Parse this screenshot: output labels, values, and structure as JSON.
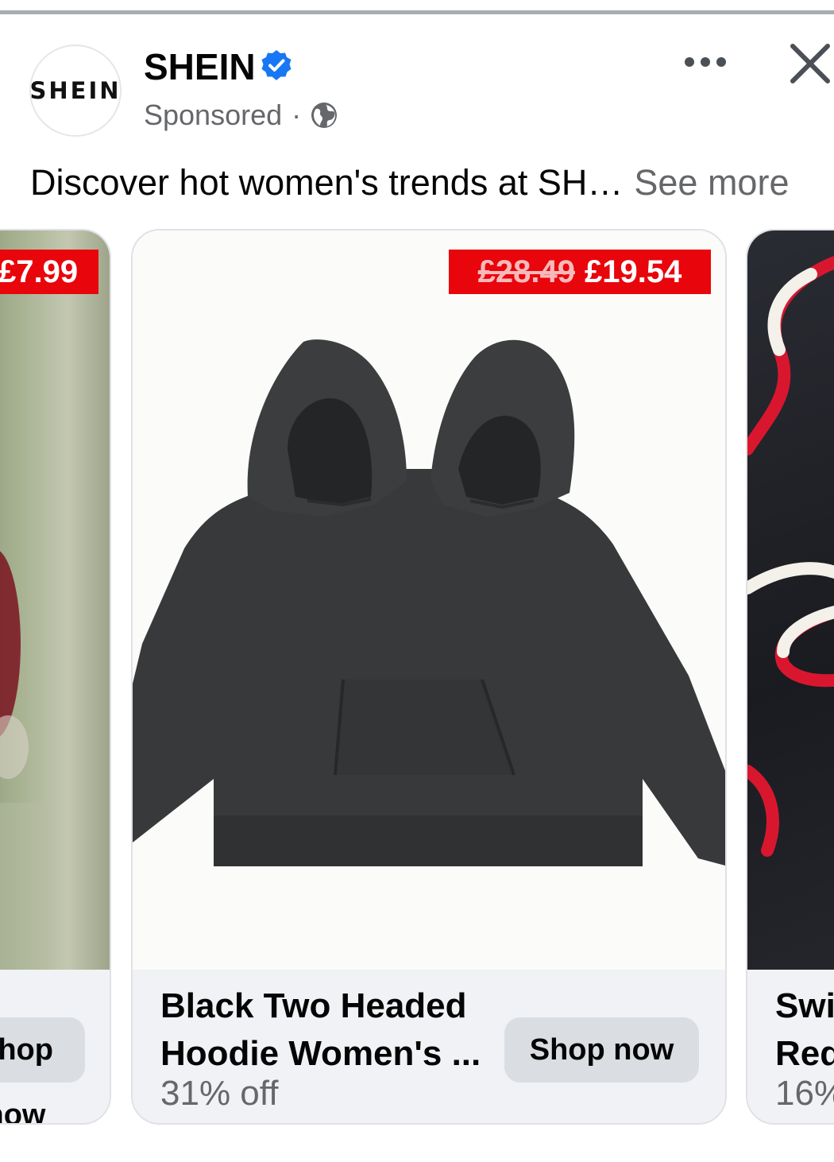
{
  "post": {
    "page_name": "SHEIN",
    "avatar_text": "SHEIN",
    "sponsored": "Sponsored",
    "separator": "·",
    "caption": "Discover hot women's trends at SH…",
    "see_more": "See more"
  },
  "carousel": {
    "cards": [
      {
        "price_new": "£7.99",
        "cta": "Shop now"
      },
      {
        "price_old": "£28.49",
        "price_new": "£19.54",
        "title_line1": "Black Two Headed",
        "title_line2": "Hoodie Women's ...",
        "discount": "31% off",
        "cta": "Shop now"
      },
      {
        "title_line1": "Swi",
        "title_line2": "Red",
        "discount": "16%"
      }
    ]
  },
  "colors": {
    "price_badge": "#e8050b",
    "verified": "#1877f2",
    "secondary_text": "#65676b",
    "card_footer": "#f0f2f5",
    "shop_button": "#dadde2"
  },
  "icons": [
    "verified-badge-icon",
    "globe-icon",
    "more-options-icon",
    "close-icon"
  ]
}
